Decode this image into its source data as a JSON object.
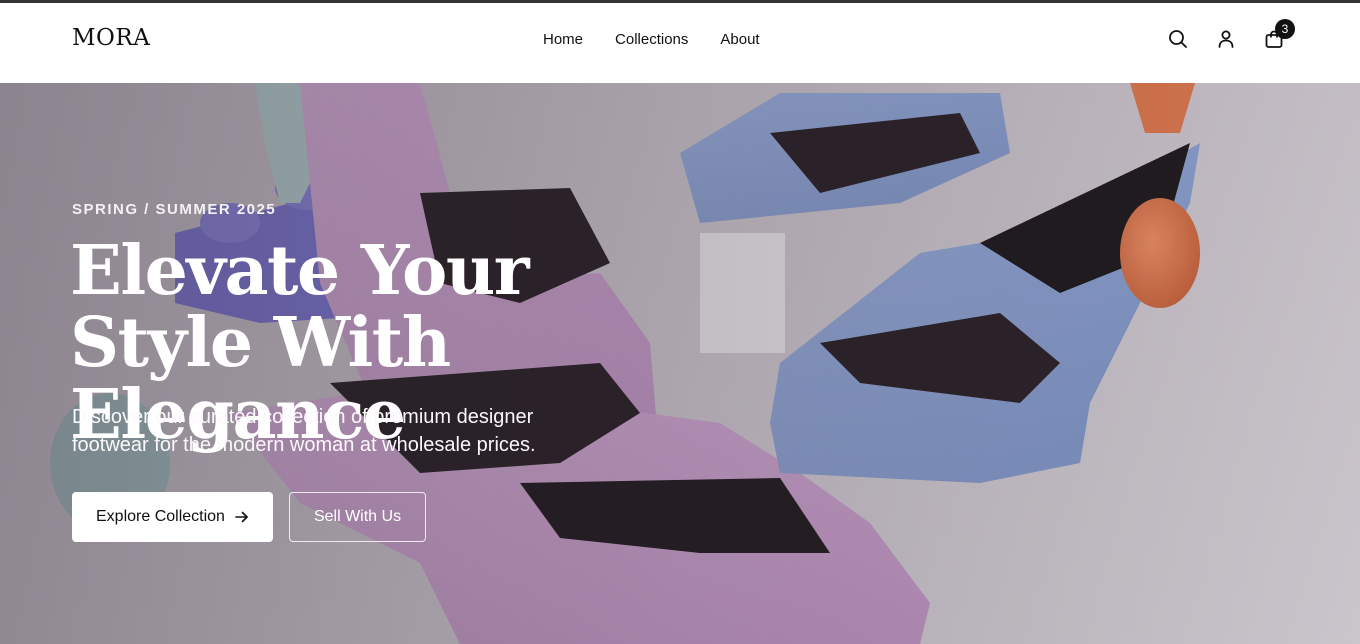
{
  "brand": {
    "logo": "MORA"
  },
  "nav": {
    "links": [
      {
        "label": "Home"
      },
      {
        "label": "Collections"
      },
      {
        "label": "About"
      }
    ],
    "icons": [
      "search-icon",
      "user-icon",
      "bag-icon"
    ],
    "cart_count": "3"
  },
  "hero": {
    "eyebrow": "SPRING / SUMMER 2025",
    "headline_line1": "Elevate Your",
    "headline_line2": "Style With Elegance",
    "subtext": "Discover our curated collection of premium designer footwear for the modern woman at wholesale prices.",
    "primary_cta": "Explore Collection",
    "secondary_cta": "Sell With Us"
  },
  "colors": {
    "header_bg": "#ffffff",
    "text_dark": "#111111",
    "pink_sandal": "#cfa6cf",
    "blue_sandal": "#8fa5d6",
    "accent_orange": "#e07a4e"
  }
}
